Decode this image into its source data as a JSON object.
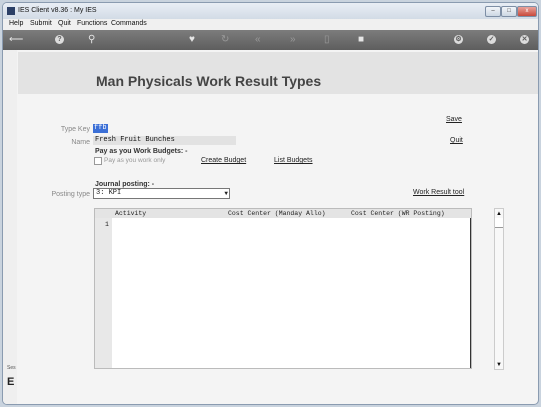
{
  "window": {
    "title": "IES Client v8.36 : My IES",
    "min": "–",
    "max": "□",
    "close": "x"
  },
  "menu": [
    "Help",
    "Submit",
    "Quit",
    "Functions",
    "Commands"
  ],
  "toolbar_icons": [
    "back-arrow-icon",
    "info-icon",
    "search-icon",
    "heart-icon",
    "refresh-icon",
    "rewind-icon",
    "forward-icon",
    "page-icon",
    "stop-icon",
    "settings-icon",
    "check-icon",
    "close-icon"
  ],
  "page": {
    "heading": "Man Physicals Work Result Types"
  },
  "links": {
    "save": "Save",
    "quit": "Quit",
    "create_budget": "Create Budget",
    "list_budgets": "List Budgets",
    "work_result_tool": "Work Result tool"
  },
  "form": {
    "type_key_label": "Type Key",
    "type_key_value": "ffb",
    "name_label": "Name",
    "name_value": "Fresh Fruit Bunches",
    "budgets_heading": "Pay as you Work Budgets: -",
    "pay_only_label": "Pay as you work only",
    "journal_heading": "Journal posting: -",
    "posting_type_label": "Posting type",
    "posting_type_value": "3: KPI"
  },
  "grid": {
    "columns": [
      "Activity",
      "Cost Center (Manday Allo)",
      "Cost Center (WR Posting)"
    ],
    "rows": [
      "1"
    ]
  },
  "sidebar": {
    "small": "Ses",
    "letter": "E"
  },
  "scroll": {
    "up": "▲",
    "down": "▼"
  }
}
